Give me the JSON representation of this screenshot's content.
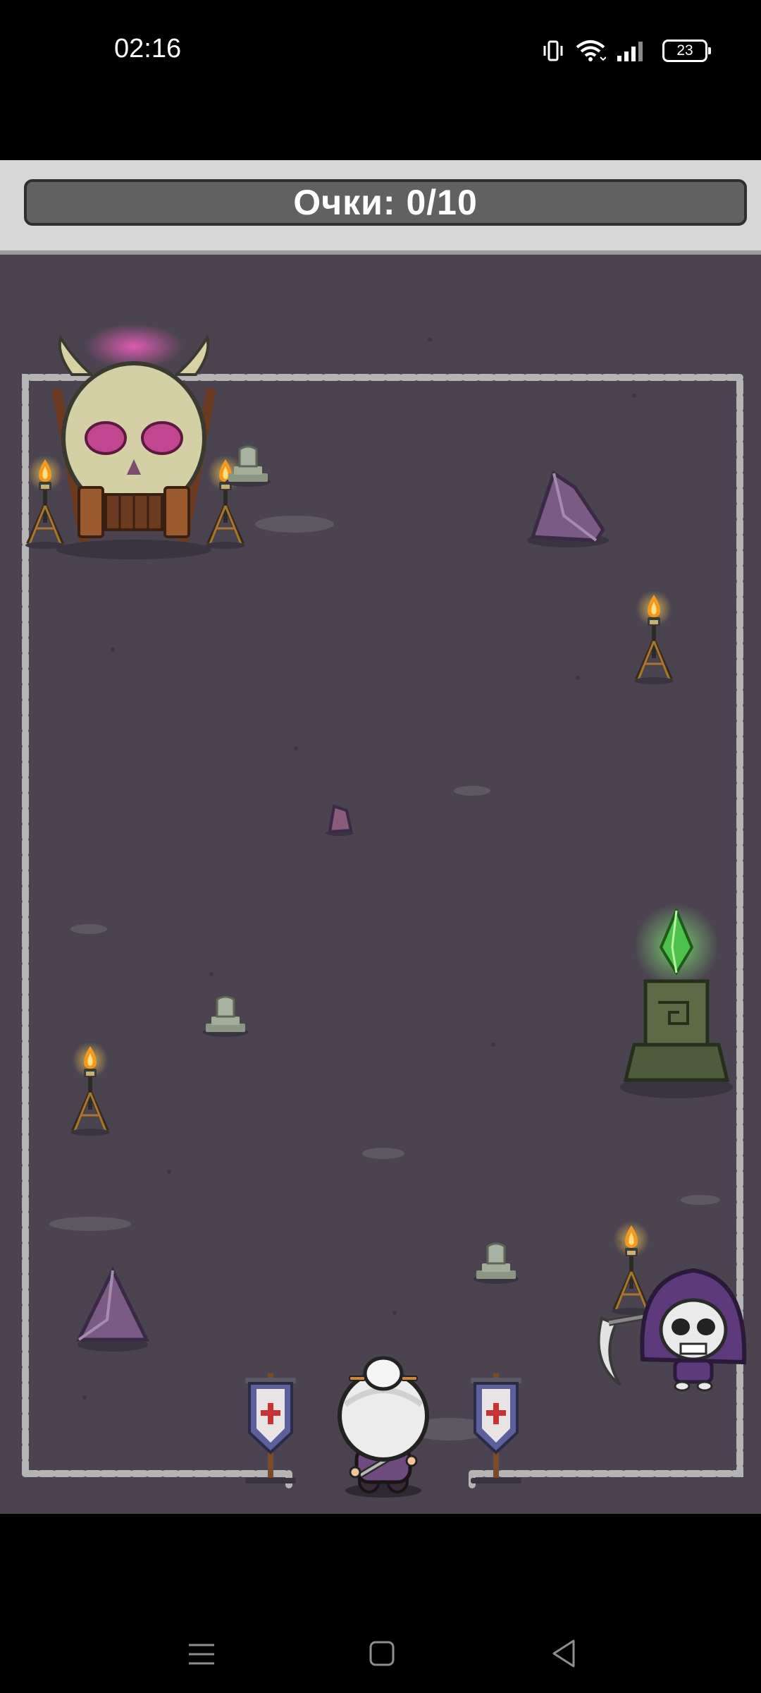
{
  "status_bar": {
    "time": "02:16",
    "battery": "23",
    "icons": [
      "vibrate-icon",
      "wifi-icon",
      "signal-icon",
      "battery-icon"
    ]
  },
  "hud": {
    "score_label": "Очки: 0/10"
  },
  "colors": {
    "ground": "#4b4350",
    "stone_wall": "#b4b4b4",
    "score_bar": "#616161",
    "crystal_green": "#4cc24a",
    "crystal_purple": "#7b5b83",
    "skull_eyes": "#c2458f"
  },
  "nav_bar": {
    "buttons": [
      "menu-icon",
      "home-icon",
      "back-icon"
    ]
  }
}
